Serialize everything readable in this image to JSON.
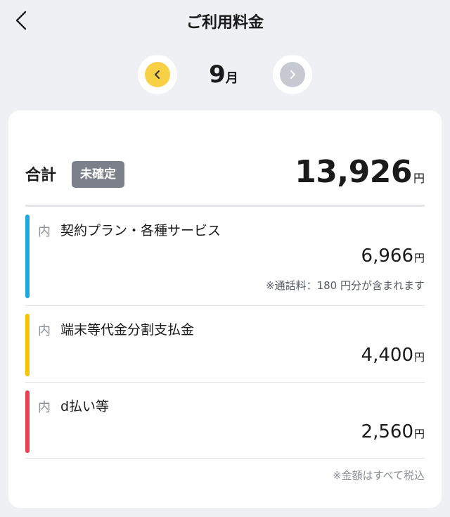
{
  "header": {
    "title": "ご利用料金",
    "back_icon": "chevron-left-icon"
  },
  "month_nav": {
    "month_number": "9",
    "month_unit": "月",
    "prev_icon": "chevron-left-icon",
    "next_icon": "chevron-right-icon",
    "prev_color": "#f7d046",
    "next_color": "#c6c9d0"
  },
  "summary": {
    "label": "合計",
    "status_badge": "未確定",
    "amount": "13,926",
    "currency": "円"
  },
  "items": [
    {
      "prefix": "内",
      "name": "契約プラン・各種サービス",
      "amount": "6,966",
      "currency": "円",
      "note": "※通話料：180 円分が含まれます",
      "color": "#1ea7e1"
    },
    {
      "prefix": "内",
      "name": "端末等代金分割支払金",
      "amount": "4,400",
      "currency": "円",
      "color": "#f5c400"
    },
    {
      "prefix": "内",
      "name": "d払い等",
      "amount": "2,560",
      "currency": "円",
      "color": "#e84050"
    }
  ],
  "footnote": "※金額はすべて税込",
  "colors": {
    "background": "#eff0f3",
    "card": "#ffffff",
    "badge": "#7c808a"
  }
}
